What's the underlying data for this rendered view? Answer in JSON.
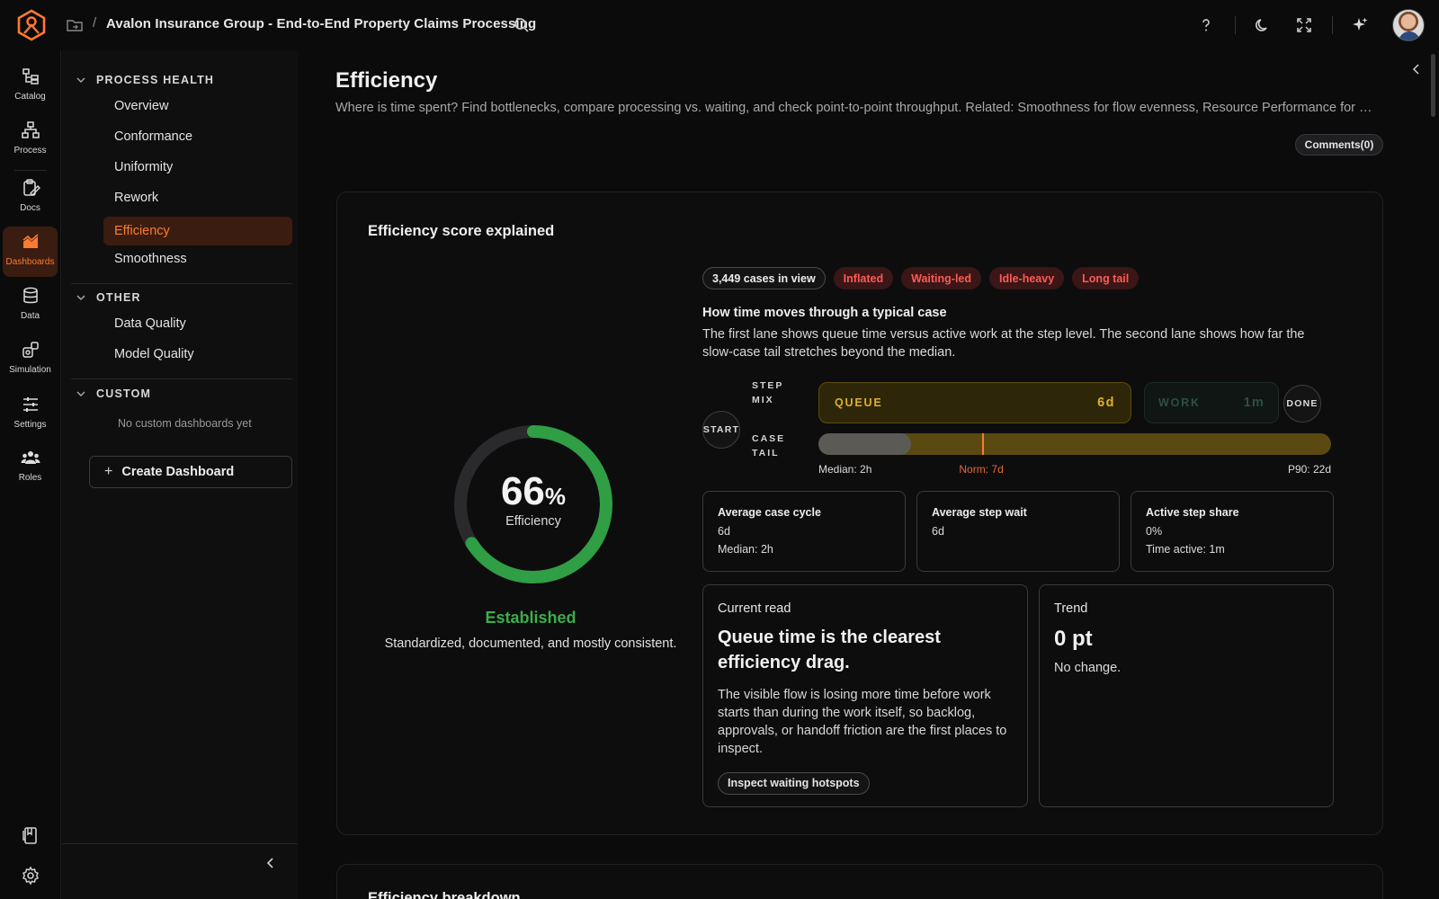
{
  "header": {
    "title": "Avalon Insurance Group - End-to-End Property Claims Processing",
    "separator": "/"
  },
  "rail": {
    "items": [
      {
        "label": "Catalog",
        "icon": "catalog-icon"
      },
      {
        "label": "Process",
        "icon": "process-icon"
      },
      {
        "label": "Docs",
        "icon": "docs-icon"
      },
      {
        "label": "Dashboards",
        "icon": "dashboards-icon",
        "active": true
      },
      {
        "label": "Data",
        "icon": "database-icon"
      },
      {
        "label": "Simulation",
        "icon": "simulation-icon"
      },
      {
        "label": "Settings",
        "icon": "sliders-icon"
      },
      {
        "label": "Roles",
        "icon": "users-icon"
      }
    ]
  },
  "sidenav": {
    "process_health": {
      "title": "PROCESS HEALTH",
      "items": [
        "Overview",
        "Conformance",
        "Uniformity",
        "Rework",
        "Efficiency",
        "Smoothness"
      ],
      "active": "Efficiency"
    },
    "other": {
      "title": "OTHER",
      "items": [
        "Data Quality",
        "Model Quality"
      ]
    },
    "custom": {
      "title": "CUSTOM",
      "empty": "No custom dashboards yet"
    },
    "create_label": "Create Dashboard"
  },
  "page": {
    "title": "Efficiency",
    "description": "Where is time spent? Find bottlenecks, compare processing vs. waiting, and check point-to-point throughput. Related: Smoothness for flow evenness, Resource Performance for team workload.",
    "comments_label": "Comments(0)"
  },
  "score_card": {
    "title": "Efficiency score explained",
    "score": 66,
    "score_unit": "%",
    "score_label": "Efficiency",
    "level": "Established",
    "level_description": "Standardized, documented, and mostly consistent.",
    "colors": {
      "score": "#2f9e44",
      "track": "#2a2a2c",
      "level": "#3cae4a"
    }
  },
  "chips": {
    "cases": "3,449 cases in view",
    "tags": [
      "Inflated",
      "Waiting-led",
      "Idle-heavy",
      "Long tail"
    ]
  },
  "flow": {
    "title": "How time moves through a typical case",
    "description": "The first lane shows queue time versus active work at the step level. The second lane shows how far the slow-case tail stretches beyond the median.",
    "start_label": "START",
    "done_label": "DONE",
    "step_mix_label": [
      "STEP",
      "MIX"
    ],
    "case_tail_label": [
      "CASE",
      "TAIL"
    ],
    "queue": {
      "name": "QUEUE",
      "value": "6d"
    },
    "work": {
      "name": "WORK",
      "value": "1m"
    },
    "tail": {
      "median_label": "Median: 2h",
      "norm_label": "Norm: 7d",
      "p90_label": "P90: 22d",
      "median_fraction": 0.18,
      "norm_fraction": 0.32
    }
  },
  "stats": [
    {
      "title": "Average case cycle",
      "value": "6d",
      "sub": "Median: 2h"
    },
    {
      "title": "Average step wait",
      "value": "6d",
      "sub": ""
    },
    {
      "title": "Active step share",
      "value": "0%",
      "sub": "Time active: 1m"
    }
  ],
  "current_read": {
    "title": "Current read",
    "headline": "Queue time is the clearest efficiency drag.",
    "body": "The visible flow is losing more time before work starts than during the work itself, so backlog, approvals, or handoff friction are the first places to inspect.",
    "action": "Inspect waiting hotspots"
  },
  "trend": {
    "title": "Trend",
    "value": "0 pt",
    "sub": "No change."
  },
  "next_card": {
    "title": "Efficiency breakdown"
  }
}
